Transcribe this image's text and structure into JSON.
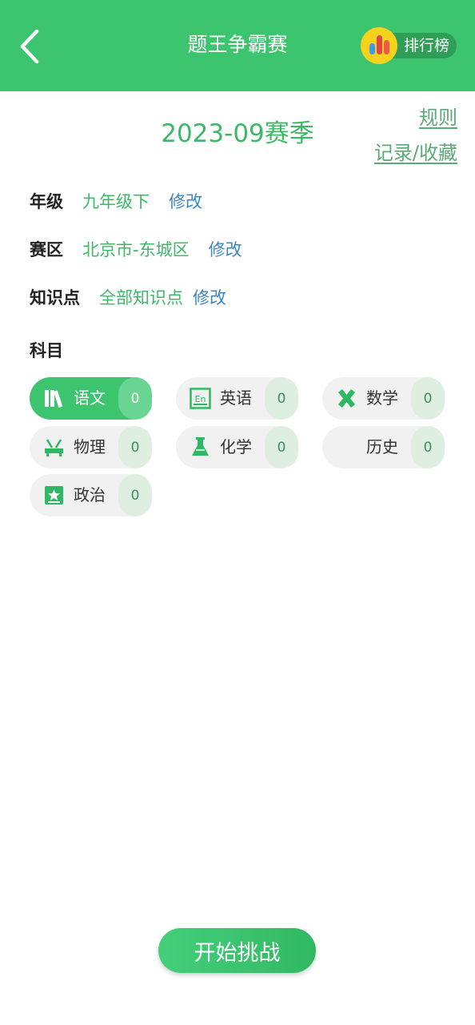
{
  "header": {
    "title": "题王争霸赛",
    "ranking_label": "排行榜"
  },
  "season": "2023-09赛季",
  "links": {
    "rules": "规则",
    "records": "记录/收藏"
  },
  "settings": [
    {
      "label": "年级",
      "value": "九年级下",
      "edit": "修改"
    },
    {
      "label": "赛区",
      "value": "北京市-东城区",
      "edit": "修改"
    },
    {
      "label": "知识点",
      "value": "全部知识点",
      "edit": "修改"
    }
  ],
  "subjects_heading": "科目",
  "subjects": [
    {
      "label": "语文",
      "count": "0",
      "icon": "books-icon",
      "selected": true
    },
    {
      "label": "英语",
      "count": "0",
      "icon": "english-icon",
      "selected": false
    },
    {
      "label": "数学",
      "count": "0",
      "icon": "math-icon",
      "selected": false
    },
    {
      "label": "物理",
      "count": "0",
      "icon": "physics-icon",
      "selected": false
    },
    {
      "label": "化学",
      "count": "0",
      "icon": "flask-icon",
      "selected": false
    },
    {
      "label": "历史",
      "count": "0",
      "icon": "",
      "selected": false
    },
    {
      "label": "政治",
      "count": "0",
      "icon": "star-badge-icon",
      "selected": false
    }
  ],
  "start_button": "开始挑战",
  "colors": {
    "brand": "#3cc46e",
    "value_text": "#3cb868",
    "edit_link": "#3a86c8"
  }
}
